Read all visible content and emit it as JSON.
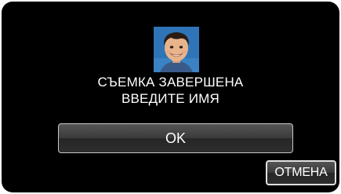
{
  "dialog": {
    "message_line1": "СЪЕМКА ЗАВЕРШЕНА",
    "message_line2": "ВВЕДИТЕ ИМЯ",
    "ok_label": "OK",
    "cancel_label": "ОТМЕНА"
  },
  "colors": {
    "background": "#000000",
    "text": "#ffffff",
    "button_border": "#c8c8c8",
    "photo_background": "#2f74b6"
  }
}
